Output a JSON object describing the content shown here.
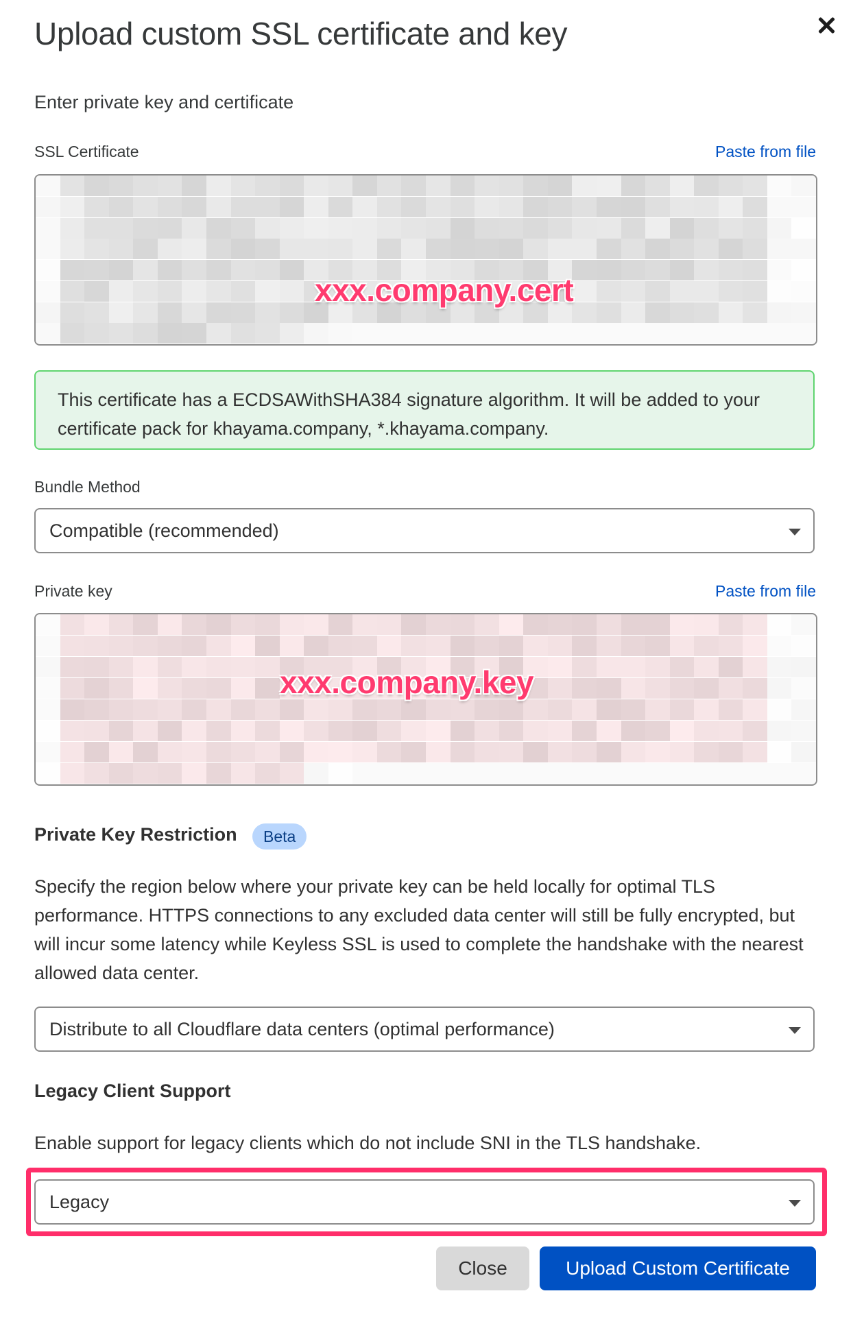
{
  "dialog": {
    "title": "Upload custom SSL certificate and key",
    "subtitle": "Enter private key and certificate"
  },
  "ssl_certificate": {
    "label": "SSL Certificate",
    "paste_link": "Paste from file",
    "overlay_text": "xxx.company.cert"
  },
  "notice": {
    "text": "This certificate has a ECDSAWithSHA384 signature algorithm. It will be added to your certificate pack for khayama.company, *.khayama.company."
  },
  "bundle_method": {
    "label": "Bundle Method",
    "selected": "Compatible (recommended)"
  },
  "private_key": {
    "label": "Private key",
    "paste_link": "Paste from file",
    "overlay_text": "xxx.company.key"
  },
  "key_restriction": {
    "heading": "Private Key Restriction",
    "badge": "Beta",
    "description": "Specify the region below where your private key can be held locally for optimal TLS performance. HTTPS connections to any excluded data center will still be fully encrypted, but will incur some latency while Keyless SSL is used to complete the handshake with the nearest allowed data center.",
    "selected": "Distribute to all Cloudflare data centers (optimal performance)"
  },
  "legacy_support": {
    "heading": "Legacy Client Support",
    "description": "Enable support for legacy clients which do not include SNI in the TLS handshake.",
    "selected": "Legacy"
  },
  "actions": {
    "close_label": "Close",
    "upload_label": "Upload Custom Certificate"
  },
  "colors": {
    "accent": "#0051c3",
    "notice_bg": "#e6f5ea",
    "notice_border": "#5fd46f",
    "highlight": "#ff2e6a",
    "badge_bg": "#b9d6fd"
  }
}
